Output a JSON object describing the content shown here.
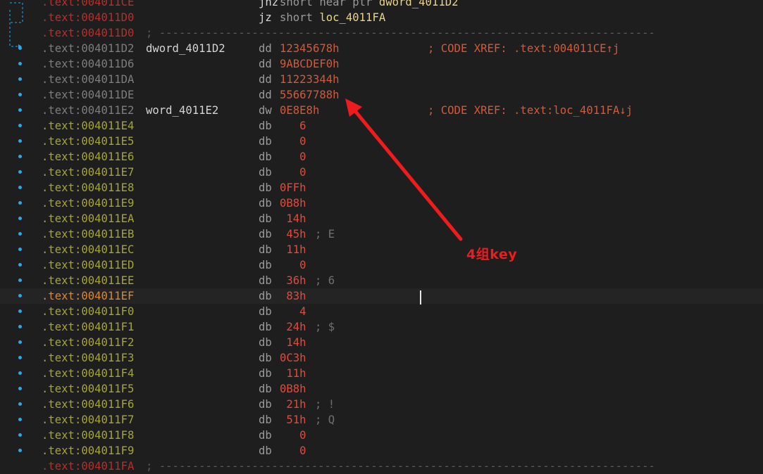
{
  "listing": {
    "lines": [
      {
        "addr": ".text:004011CE",
        "addr_color": "red",
        "label": "",
        "mnem": "jnz",
        "mnem_class": "kw",
        "op": [
          {
            "t": "short near ptr ",
            "c": "kw"
          },
          {
            "t": "dword_4011D2",
            "c": "ref"
          }
        ],
        "cmt": "",
        "xref": ""
      },
      {
        "addr": ".text:004011D0",
        "addr_color": "red",
        "label": "",
        "mnem": "jz",
        "mnem_class": "kw",
        "op": [
          {
            "t": "short ",
            "c": "kw"
          },
          {
            "t": "loc_4011FA",
            "c": "ref"
          }
        ],
        "cmt": "",
        "xref": ""
      },
      {
        "addr": ".text:004011D0",
        "addr_color": "red",
        "separator": "; ---------------------------------------------------------------------------"
      },
      {
        "addr": ".text:004011D2",
        "addr_color": "grey",
        "label": "dword_4011D2",
        "mnem": "dd",
        "mnem_class": "dir",
        "op": [
          {
            "t": "12345678h",
            "c": "num-dd"
          }
        ],
        "cmt": "",
        "xref": "; CODE XREF: .text:004011CE↑j"
      },
      {
        "addr": ".text:004011D6",
        "addr_color": "grey",
        "label": "",
        "mnem": "dd",
        "mnem_class": "dir",
        "op": [
          {
            "t": "9ABCDEF0h",
            "c": "num-dd"
          }
        ],
        "cmt": "",
        "xref": ""
      },
      {
        "addr": ".text:004011DA",
        "addr_color": "grey",
        "label": "",
        "mnem": "dd",
        "mnem_class": "dir",
        "op": [
          {
            "t": "11223344h",
            "c": "num-dd"
          }
        ],
        "cmt": "",
        "xref": ""
      },
      {
        "addr": ".text:004011DE",
        "addr_color": "grey",
        "label": "",
        "mnem": "dd",
        "mnem_class": "dir",
        "op": [
          {
            "t": "55667788h",
            "c": "num-dd"
          }
        ],
        "cmt": "",
        "xref": ""
      },
      {
        "addr": ".text:004011E2",
        "addr_color": "grey",
        "label": "word_4011E2",
        "mnem": "dw",
        "mnem_class": "dir",
        "op": [
          {
            "t": "0E8E8h",
            "c": "num-dd"
          }
        ],
        "cmt": "",
        "xref": "; CODE XREF: .text:loc_4011FA↓j"
      },
      {
        "addr": ".text:004011E4",
        "addr_color": "yellow",
        "label": "",
        "mnem": "db",
        "mnem_class": "dir",
        "op": [
          {
            "t": "   6",
            "c": "num-db"
          }
        ],
        "cmt": "",
        "xref": ""
      },
      {
        "addr": ".text:004011E5",
        "addr_color": "yellow",
        "label": "",
        "mnem": "db",
        "mnem_class": "dir",
        "op": [
          {
            "t": "   0",
            "c": "num-db"
          }
        ],
        "cmt": "",
        "xref": ""
      },
      {
        "addr": ".text:004011E6",
        "addr_color": "yellow",
        "label": "",
        "mnem": "db",
        "mnem_class": "dir",
        "op": [
          {
            "t": "   0",
            "c": "num-db"
          }
        ],
        "cmt": "",
        "xref": ""
      },
      {
        "addr": ".text:004011E7",
        "addr_color": "yellow",
        "label": "",
        "mnem": "db",
        "mnem_class": "dir",
        "op": [
          {
            "t": "   0",
            "c": "num-db"
          }
        ],
        "cmt": "",
        "xref": ""
      },
      {
        "addr": ".text:004011E8",
        "addr_color": "yellow",
        "label": "",
        "mnem": "db",
        "mnem_class": "dir",
        "op": [
          {
            "t": "0FFh",
            "c": "num-db"
          }
        ],
        "cmt": "",
        "xref": ""
      },
      {
        "addr": ".text:004011E9",
        "addr_color": "yellow",
        "label": "",
        "mnem": "db",
        "mnem_class": "dir",
        "op": [
          {
            "t": "0B8h",
            "c": "num-db"
          }
        ],
        "cmt": "",
        "xref": ""
      },
      {
        "addr": ".text:004011EA",
        "addr_color": "yellow",
        "label": "",
        "mnem": "db",
        "mnem_class": "dir",
        "op": [
          {
            "t": " 14h",
            "c": "num-db"
          }
        ],
        "cmt": "",
        "xref": ""
      },
      {
        "addr": ".text:004011EB",
        "addr_color": "yellow",
        "label": "",
        "mnem": "db",
        "mnem_class": "dir",
        "op": [
          {
            "t": " 45h",
            "c": "num-db"
          }
        ],
        "cmt": "; E",
        "xref": ""
      },
      {
        "addr": ".text:004011EC",
        "addr_color": "yellow",
        "label": "",
        "mnem": "db",
        "mnem_class": "dir",
        "op": [
          {
            "t": " 11h",
            "c": "num-db"
          }
        ],
        "cmt": "",
        "xref": ""
      },
      {
        "addr": ".text:004011ED",
        "addr_color": "yellow",
        "label": "",
        "mnem": "db",
        "mnem_class": "dir",
        "op": [
          {
            "t": "   0",
            "c": "num-db"
          }
        ],
        "cmt": "",
        "xref": ""
      },
      {
        "addr": ".text:004011EE",
        "addr_color": "yellow",
        "label": "",
        "mnem": "db",
        "mnem_class": "dir",
        "op": [
          {
            "t": " 36h",
            "c": "num-db"
          }
        ],
        "cmt": "; 6",
        "xref": ""
      },
      {
        "addr": ".text:004011EF",
        "addr_color": "orange",
        "current": true,
        "label": "",
        "mnem": "db",
        "mnem_class": "dir",
        "op": [
          {
            "t": " 83h",
            "c": "num-db"
          }
        ],
        "cmt": "",
        "xref": ""
      },
      {
        "addr": ".text:004011F0",
        "addr_color": "yellow",
        "label": "",
        "mnem": "db",
        "mnem_class": "dir",
        "op": [
          {
            "t": "   4",
            "c": "num-db"
          }
        ],
        "cmt": "",
        "xref": ""
      },
      {
        "addr": ".text:004011F1",
        "addr_color": "yellow",
        "label": "",
        "mnem": "db",
        "mnem_class": "dir",
        "op": [
          {
            "t": " 24h",
            "c": "num-db"
          }
        ],
        "cmt": "; $",
        "xref": ""
      },
      {
        "addr": ".text:004011F2",
        "addr_color": "yellow",
        "label": "",
        "mnem": "db",
        "mnem_class": "dir",
        "op": [
          {
            "t": " 14h",
            "c": "num-db"
          }
        ],
        "cmt": "",
        "xref": ""
      },
      {
        "addr": ".text:004011F3",
        "addr_color": "yellow",
        "label": "",
        "mnem": "db",
        "mnem_class": "dir",
        "op": [
          {
            "t": "0C3h",
            "c": "num-db"
          }
        ],
        "cmt": "",
        "xref": ""
      },
      {
        "addr": ".text:004011F4",
        "addr_color": "yellow",
        "label": "",
        "mnem": "db",
        "mnem_class": "dir",
        "op": [
          {
            "t": " 11h",
            "c": "num-db"
          }
        ],
        "cmt": "",
        "xref": ""
      },
      {
        "addr": ".text:004011F5",
        "addr_color": "yellow",
        "label": "",
        "mnem": "db",
        "mnem_class": "dir",
        "op": [
          {
            "t": "0B8h",
            "c": "num-db"
          }
        ],
        "cmt": "",
        "xref": ""
      },
      {
        "addr": ".text:004011F6",
        "addr_color": "yellow",
        "label": "",
        "mnem": "db",
        "mnem_class": "dir",
        "op": [
          {
            "t": " 21h",
            "c": "num-db"
          }
        ],
        "cmt": "; !",
        "xref": ""
      },
      {
        "addr": ".text:004011F7",
        "addr_color": "yellow",
        "label": "",
        "mnem": "db",
        "mnem_class": "dir",
        "op": [
          {
            "t": " 51h",
            "c": "num-db"
          }
        ],
        "cmt": "; Q",
        "xref": ""
      },
      {
        "addr": ".text:004011F8",
        "addr_color": "yellow",
        "label": "",
        "mnem": "db",
        "mnem_class": "dir",
        "op": [
          {
            "t": "   0",
            "c": "num-db"
          }
        ],
        "cmt": "",
        "xref": ""
      },
      {
        "addr": ".text:004011F9",
        "addr_color": "yellow",
        "label": "",
        "mnem": "db",
        "mnem_class": "dir",
        "op": [
          {
            "t": "   0",
            "c": "num-db"
          }
        ],
        "cmt": "",
        "xref": ""
      },
      {
        "addr": ".text:004011FA",
        "addr_color": "red",
        "separator": "; ---------------------------------------------------------------------------"
      }
    ]
  },
  "annotation": {
    "text": "4组key",
    "color": "#ee1c1c"
  },
  "colors": {
    "background": "#1e1e1e",
    "bullet": "#2fa7e4",
    "flow_arrow": "#2fa7e4"
  }
}
